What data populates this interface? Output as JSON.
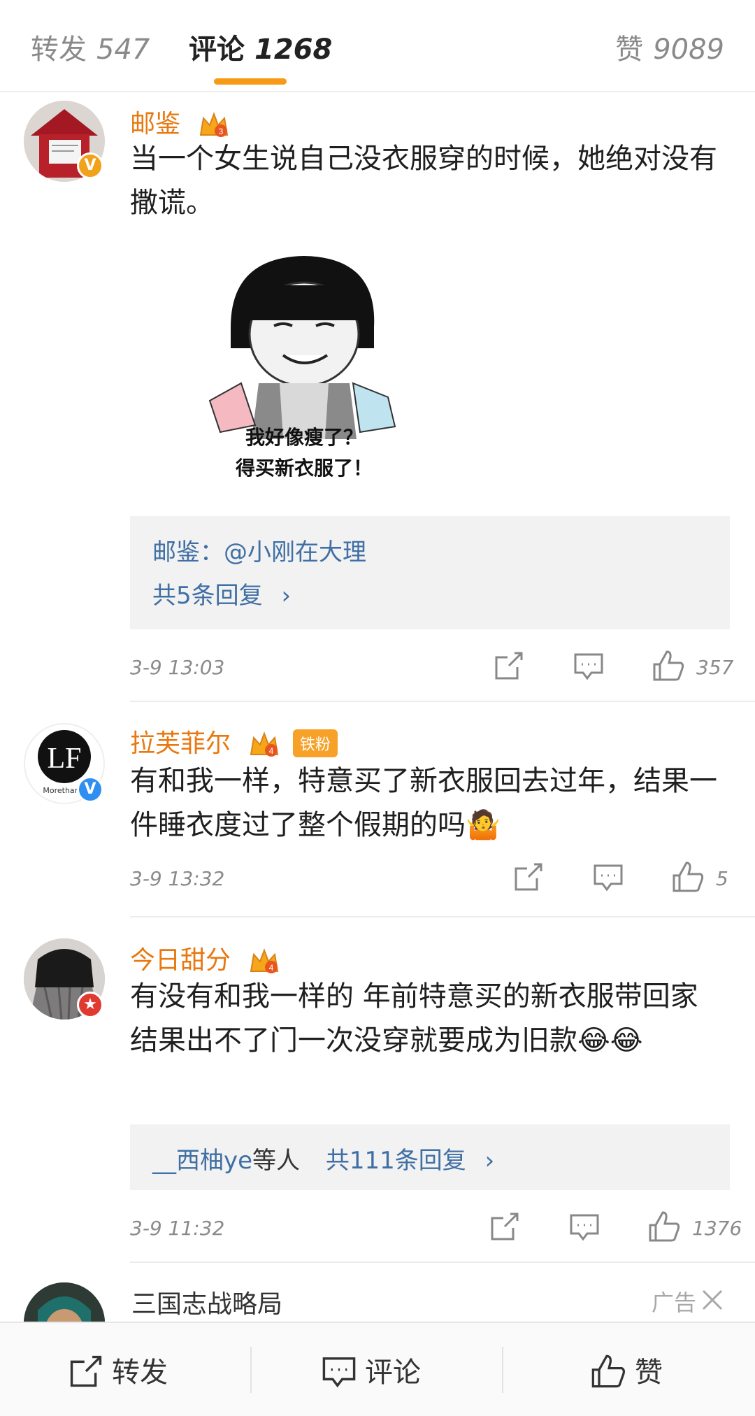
{
  "tabs": {
    "repost": {
      "label": "转发",
      "count": "547"
    },
    "comment": {
      "label": "评论",
      "count": "1268"
    },
    "like": {
      "label": "赞",
      "count": "9089"
    }
  },
  "comments": [
    {
      "username": "邮鉴",
      "text": "当一个女生说自己没衣服穿的时候，她绝对没有撒谎。",
      "meme": {
        "line1": "我好像瘦了？",
        "line2": "得买新衣服了！"
      },
      "reply_preview": "邮鉴：@小刚在大理",
      "reply_total": "共5条回复",
      "time": "3-9 13:03",
      "likes": "357"
    },
    {
      "username": "拉芙菲尔",
      "fan_tag": "铁粉",
      "avatar_text": "Morethanw",
      "text": "有和我一样，特意买了新衣服回去过年，结果一件睡衣度过了整个假期的吗🤷",
      "time": "3-9 13:32",
      "likes": "5"
    },
    {
      "username": "今日甜分",
      "text": "有没有和我一样的 年前特意买的新衣服带回家 结果出不了门一次没穿就要成为旧款😂😂",
      "reply_user": "__西柚ye",
      "reply_suffix": "等人",
      "reply_total": "共111条回复",
      "time": "3-9 11:32",
      "likes": "1376"
    }
  ],
  "ad": {
    "name": "三国志战略局",
    "label": "广告"
  },
  "bottom_bar": {
    "repost": "转发",
    "comment": "评论",
    "like": "赞"
  }
}
